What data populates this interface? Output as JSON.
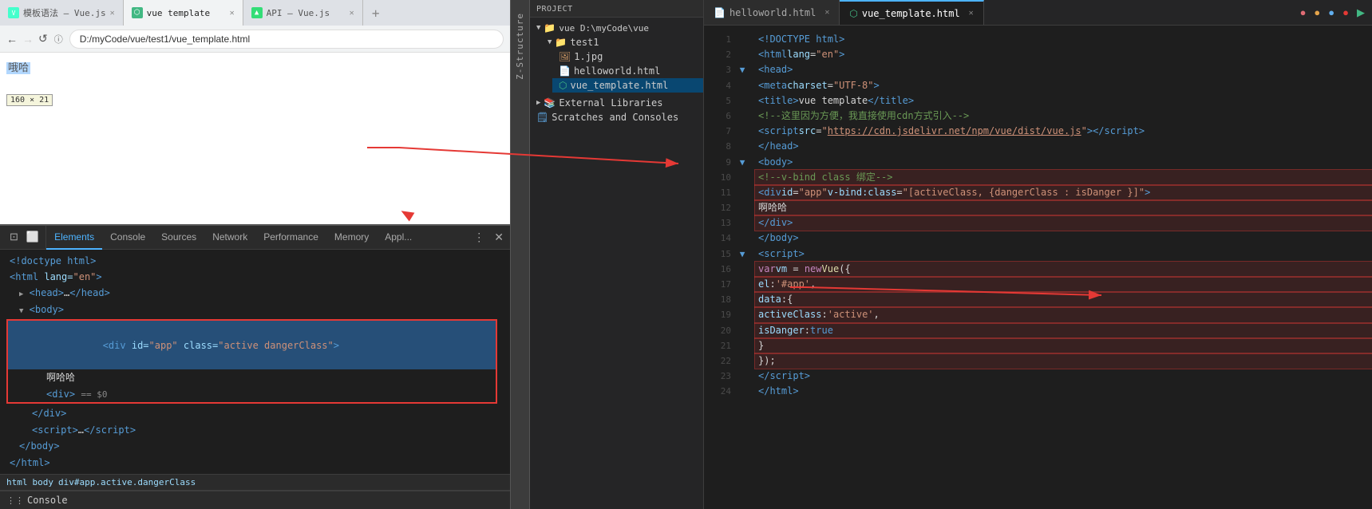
{
  "browser": {
    "tabs": [
      {
        "label": "模板语法 — Vue.js",
        "active": false,
        "id": "tab1"
      },
      {
        "label": "vue template",
        "active": true,
        "id": "tab2"
      },
      {
        "label": "API — Vue.js",
        "active": false,
        "id": "tab3"
      }
    ],
    "url": "D:/myCode/vue/test1/vue_template.html",
    "viewport_text": "哦哈",
    "size_badge": "160 × 21"
  },
  "devtools": {
    "tabs": [
      "Elements",
      "Console",
      "Sources",
      "Network",
      "Performance",
      "Memory",
      "Appl..."
    ],
    "active_tab": "Elements",
    "dom_lines": [
      "<!doctype html>",
      "<html lang=\"en\">",
      "▶ <head>…</head>",
      "▼ <body>",
      "  <div id=\"app\" class=\"active dangerClass\">",
      "    啊哈哈",
      "    <div> == $0",
      "  </div>",
      "  <script>…</script>",
      "</body>",
      "</html>"
    ],
    "breadcrumb": [
      "html",
      "body",
      "div#app.active.dangerClass"
    ],
    "console_label": "Console"
  },
  "filetree": {
    "header": "Project",
    "items": [
      {
        "label": "vue D:\\myCode\\vue",
        "level": 0,
        "type": "folder",
        "open": true
      },
      {
        "label": "test1",
        "level": 1,
        "type": "folder",
        "open": true
      },
      {
        "label": "1.jpg",
        "level": 2,
        "type": "jpg"
      },
      {
        "label": "helloworld.html",
        "level": 2,
        "type": "html"
      },
      {
        "label": "vue_template.html",
        "level": 2,
        "type": "vue",
        "selected": true
      },
      {
        "label": "External Libraries",
        "level": 0,
        "type": "lib"
      },
      {
        "label": "Scratches and Consoles",
        "level": 0,
        "type": "lib"
      }
    ]
  },
  "editor": {
    "tabs": [
      {
        "label": "helloworld.html",
        "active": false
      },
      {
        "label": "vue_template.html",
        "active": true
      }
    ],
    "lines": [
      {
        "n": 1,
        "hl": false,
        "code": "html"
      },
      {
        "n": 2,
        "hl": false,
        "code": "html_lang"
      },
      {
        "n": 3,
        "hl": false,
        "code": "head_open"
      },
      {
        "n": 4,
        "hl": false,
        "code": "meta"
      },
      {
        "n": 5,
        "hl": false,
        "code": "title"
      },
      {
        "n": 6,
        "hl": false,
        "code": "comment1"
      },
      {
        "n": 7,
        "hl": false,
        "code": "script_src"
      },
      {
        "n": 8,
        "hl": false,
        "code": "head_close"
      },
      {
        "n": 9,
        "hl": false,
        "code": "body_open"
      },
      {
        "n": 10,
        "hl": true,
        "code": "comment_vbind"
      },
      {
        "n": 11,
        "hl": true,
        "code": "div_app"
      },
      {
        "n": 12,
        "hl": true,
        "code": "text_ahaha"
      },
      {
        "n": 13,
        "hl": true,
        "code": "div_close"
      },
      {
        "n": 14,
        "hl": false,
        "code": "body_close"
      },
      {
        "n": 15,
        "hl": false,
        "code": "script_open"
      },
      {
        "n": 16,
        "hl": true,
        "code": "var_vm"
      },
      {
        "n": 17,
        "hl": true,
        "code": "el"
      },
      {
        "n": 18,
        "hl": true,
        "code": "data_open"
      },
      {
        "n": 19,
        "hl": true,
        "code": "active_class"
      },
      {
        "n": 20,
        "hl": true,
        "code": "is_danger"
      },
      {
        "n": 21,
        "hl": true,
        "code": "data_close"
      },
      {
        "n": 22,
        "hl": true,
        "code": "vue_close"
      },
      {
        "n": 23,
        "hl": false,
        "code": "script_close"
      },
      {
        "n": 24,
        "hl": false,
        "code": "html_close"
      }
    ]
  },
  "structure_label": "Z-Structure"
}
